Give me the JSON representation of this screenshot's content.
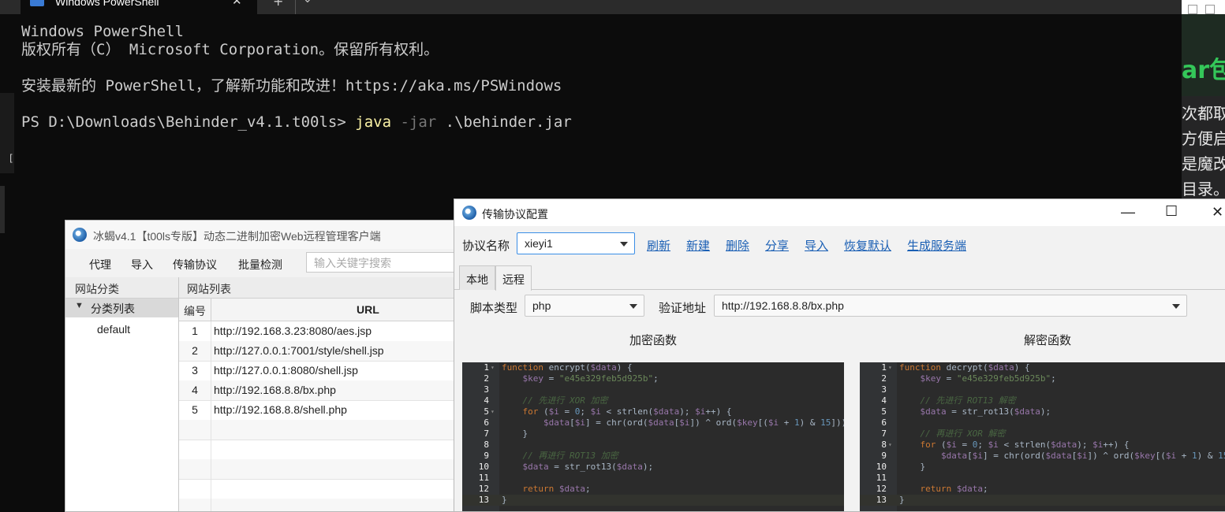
{
  "powershell": {
    "tab_title": "Windows PowerShell",
    "close": "✕",
    "new_tab": "+",
    "dropdown": "⌄",
    "lines": [
      "Windows PowerShell",
      "版权所有（C） Microsoft Corporation。保留所有权利。",
      "",
      "安装最新的 PowerShell，了解新功能和改进！https://aka.ms/PSWindows",
      ""
    ],
    "prompt": "PS D:\\Downloads\\Behinder_v4.1.t00ls> ",
    "cmd": "java",
    "param": " -jar",
    "arg": " .\\behinder.jar",
    "side_glyph": "["
  },
  "bg_page": {
    "heading": "ar包",
    "lines": [
      "次都取",
      "方便启",
      "是魔改",
      "目录。"
    ]
  },
  "behinder": {
    "title": "冰蝎v4.1【t00ls专版】动态二进制加密Web远程管理客户端",
    "menu": [
      "代理",
      "导入",
      "传输协议",
      "批量检测"
    ],
    "search_placeholder": "输入关键字搜索",
    "side_header": "网站分类",
    "category_root": "分类列表",
    "category_default": "default",
    "list_header": "网站列表",
    "col_num": "编号",
    "col_url": "URL",
    "rows": [
      {
        "n": "1",
        "url": "http://192.168.3.23:8080/aes.jsp"
      },
      {
        "n": "2",
        "url": "http://127.0.0.1:7001/style/shell.jsp"
      },
      {
        "n": "3",
        "url": "http://127.0.0.1:8080/shell.jsp"
      },
      {
        "n": "4",
        "url": "http://192.168.8.8/bx.php"
      },
      {
        "n": "5",
        "url": "http://192.168.8.8/shell.php"
      }
    ]
  },
  "protocol": {
    "title": "传输协议配置",
    "name_label": "协议名称",
    "name_value": "xieyi1",
    "links": [
      "刷新",
      "新建",
      "删除",
      "分享",
      "导入",
      "恢复默认",
      "生成服务端"
    ],
    "tabs": [
      "本地",
      "远程"
    ],
    "script_type_label": "脚本类型",
    "script_type_value": "php",
    "verify_label": "验证地址",
    "verify_value": "http://192.168.8.8/bx.php",
    "encrypt_header": "加密函数",
    "decrypt_header": "解密函数",
    "minimize": "—",
    "maximize": "☐",
    "close": "✕"
  },
  "encrypt_code": [
    "function encrypt($data) {",
    "    $key = \"e45e329feb5d925b\";",
    "",
    "    // 先进行 XOR 加密",
    "    for ($i = 0; $i < strlen($data); $i++) {",
    "        $data[$i] = chr(ord($data[$i]) ^ ord($key[($i + 1) & 15]));",
    "    }",
    "",
    "    // 再进行 ROT13 加密",
    "    $data = str_rot13($data);",
    "",
    "    return $data;",
    "}"
  ],
  "decrypt_code": [
    "function decrypt($data) {",
    "    $key = \"e45e329feb5d925b\";",
    "",
    "    // 先进行 ROT13 解密",
    "    $data = str_rot13($data);",
    "",
    "    // 再进行 XOR 解密",
    "    for ($i = 0; $i < strlen($data); $i++) {",
    "        $data[$i] = chr(ord($data[$i]) ^ ord($key[($i + 1) & 15]));",
    "    }",
    "",
    "    return $data;",
    "}"
  ]
}
